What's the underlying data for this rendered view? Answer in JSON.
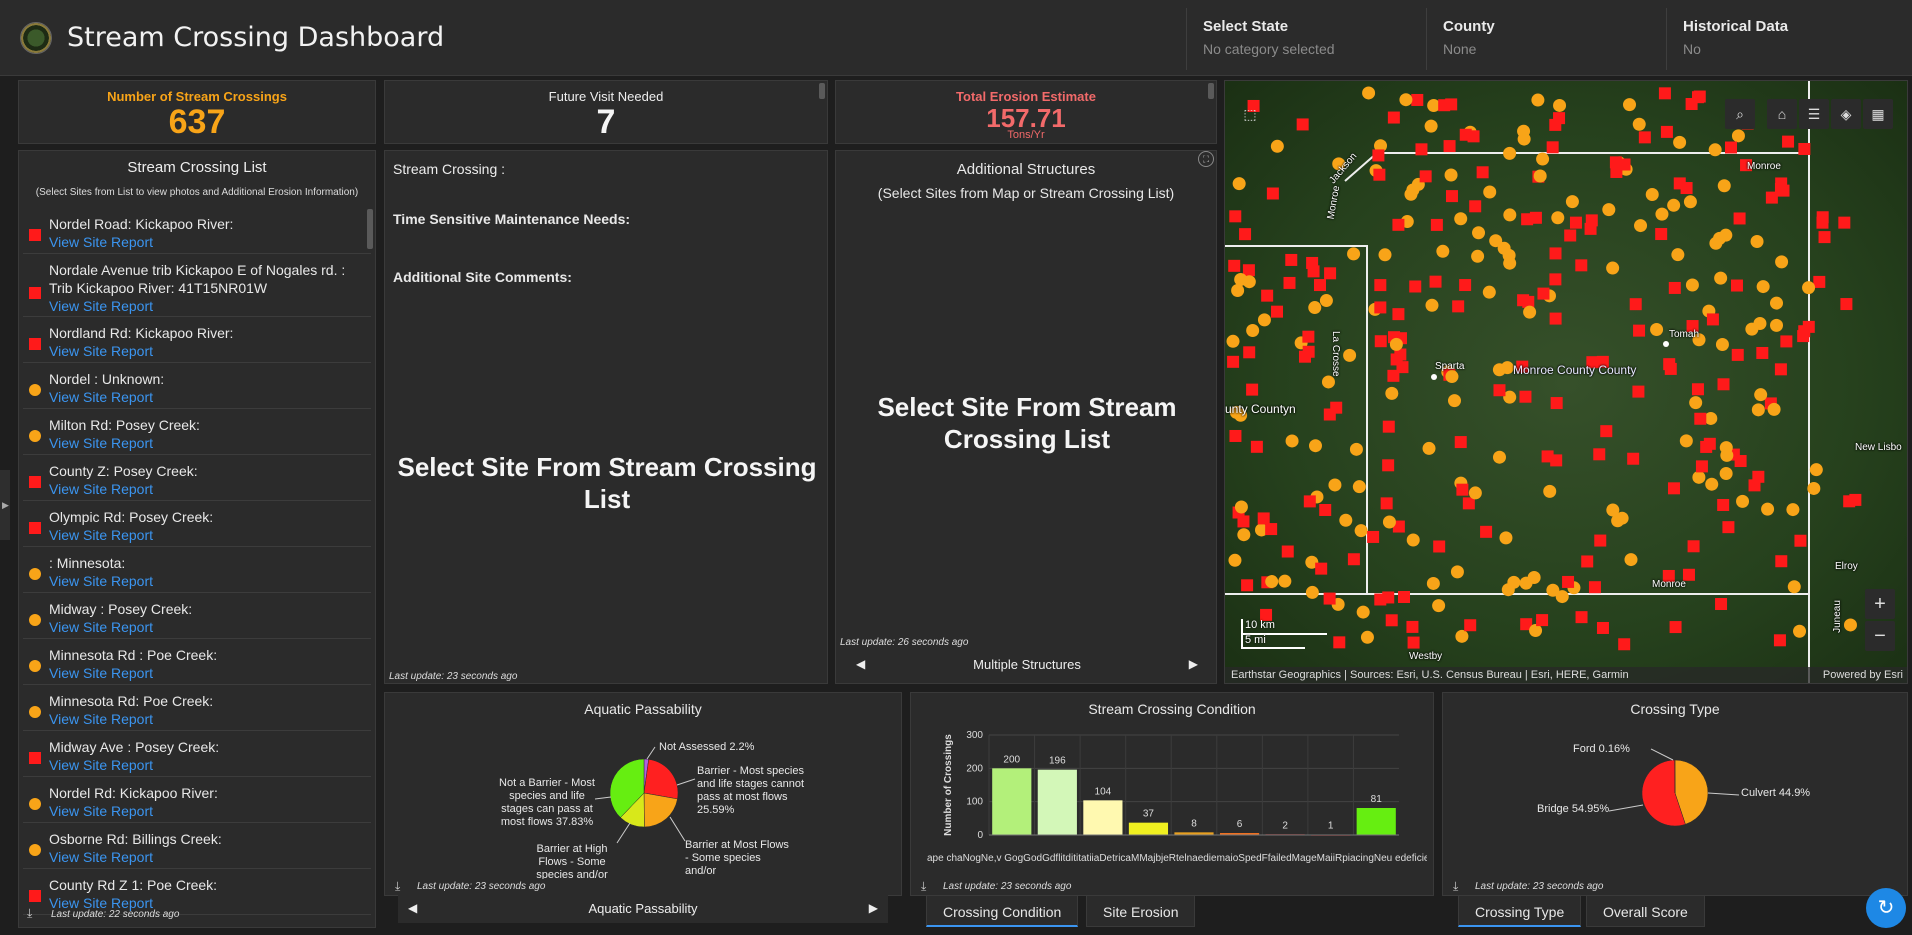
{
  "header": {
    "title": "Stream Crossing Dashboard",
    "filters": [
      {
        "label": "Select State",
        "value": "No category selected"
      },
      {
        "label": "County",
        "value": "None"
      },
      {
        "label": "Historical Data",
        "value": "No"
      }
    ]
  },
  "kpis": {
    "crossings": {
      "title": "Number of Stream Crossings",
      "value": "637",
      "color": "#f8a418"
    },
    "future_visit": {
      "title": "Future Visit Needed",
      "value": "7",
      "color": "#f5f5f5"
    },
    "erosion": {
      "title": "Total Erosion Estimate",
      "value": "157.71",
      "unit": "Tons/Yr",
      "color": "#f26a6a"
    }
  },
  "crossing_list": {
    "title": "Stream Crossing List",
    "subtitle": "(Select Sites  from List to view photos and Additional Erosion Information)",
    "link_label": "View Site Report",
    "items": [
      {
        "name": "Nordel Road: Kickapoo River:",
        "marker": "square"
      },
      {
        "name": "Nordale Avenue trib Kickapoo E of Nogales rd. : Trib Kickapoo River: 41T15NR01W",
        "marker": "square"
      },
      {
        "name": "Nordland Rd: Kickapoo River:",
        "marker": "square"
      },
      {
        "name": "Nordel : Unknown:",
        "marker": "circle"
      },
      {
        "name": "Milton Rd: Posey Creek:",
        "marker": "circle"
      },
      {
        "name": "County Z: Posey Creek:",
        "marker": "square"
      },
      {
        "name": "Olympic Rd: Posey Creek:",
        "marker": "square"
      },
      {
        "name": ": Minnesota:",
        "marker": "circle"
      },
      {
        "name": "Midway : Posey Creek:",
        "marker": "circle"
      },
      {
        "name": "Minnesota Rd : Poe Creek:",
        "marker": "circle"
      },
      {
        "name": "Minnesota Rd: Poe Creek:",
        "marker": "circle"
      },
      {
        "name": "Midway Ave : Posey Creek:",
        "marker": "square"
      },
      {
        "name": "Nordel Rd: Kickapoo River:",
        "marker": "circle"
      },
      {
        "name": "Osborne Rd: Billings Creek:",
        "marker": "circle"
      },
      {
        "name": "County Rd Z 1: Poe Creek:",
        "marker": "square"
      }
    ],
    "last_update": "Last update: 22 seconds ago"
  },
  "site_detail": {
    "stream_crossing_label": "Stream Crossing :",
    "maintenance_label": "Time Sensitive Maintenance Needs:",
    "comments_label": "Additional Site Comments:",
    "message": "Select Site From Stream Crossing List",
    "last_update": "Last update: 23 seconds ago"
  },
  "structures": {
    "title": "Additional Structures",
    "subtitle": "(Select Sites from Map or Stream Crossing List)",
    "message": "Select Site From Stream Crossing List",
    "last_update": "Last update: 26 seconds ago",
    "nav_label": "Multiple Structures"
  },
  "map": {
    "labels": {
      "jackson": "Jackson",
      "monroe_top": "Monroe",
      "monroe_left": "Monroe",
      "la_crosse": "La Crosse",
      "sparta": "Sparta",
      "tomah": "Tomah",
      "county": "Monroe County County",
      "county_left": "unty Countyn",
      "new_lisbon": "New Lisbo",
      "elroy": "Elroy",
      "monroe_bottom": "Monroe",
      "juneau": "Juneau",
      "westby": "Westby"
    },
    "scale_km": "10 km",
    "scale_mi": "5 mi",
    "attribution": "Earthstar Geographics | Sources: Esri, U.S. Census Bureau | Esri, HERE, Garmin",
    "powered_by": "Powered by Esri",
    "zoom_in": "+",
    "zoom_out": "−"
  },
  "aquatic": {
    "title": "Aquatic Passability",
    "labels": {
      "not_assessed": "Not Assessed 2.2%",
      "barrier_most": "Barrier - Most species and life stages cannot pass at most flows 25.59%",
      "barrier_high": "Barrier at Most Flows - Some species and/or",
      "not_barrier": "Not a Barrier - Most species and life stages can pass at most flows 37.83%",
      "barrier_at_high": "Barrier at High Flows - Some species and/or"
    },
    "last_update": "Last update: 23 seconds ago",
    "nav_label": "Aquatic Passability",
    "chart_data": {
      "type": "pie",
      "slices": [
        {
          "label": "Not a Barrier",
          "value": 37.83,
          "color": "#66ee11"
        },
        {
          "label": "Barrier - Most species and life stages cannot pass at most flows",
          "value": 25.59,
          "color": "#ff2020"
        },
        {
          "label": "Barrier at Most Flows",
          "value": 22.0,
          "color": "#f8a418"
        },
        {
          "label": "Barrier at High Flows",
          "value": 12.38,
          "color": "#d8e81a"
        },
        {
          "label": "Not Assessed",
          "value": 2.2,
          "color": "#b060e0"
        }
      ]
    }
  },
  "condition": {
    "title": "Stream Crossing Condition",
    "xtick_text": "ape chaNogNe,v GogGodGdflitdititatiiaDetricaMMajbjeRtelnaediemaioSpedFfailedMageMaiiRpiacingNeu edeficientbest",
    "last_update": "Last update: 23 seconds ago",
    "chart_data": {
      "type": "bar",
      "ylabel": "Number of Crossings",
      "ylim": [
        0,
        300
      ],
      "yticks": [
        0,
        100,
        200,
        300
      ],
      "values": [
        200,
        196,
        104,
        37,
        8,
        6,
        2,
        1,
        81
      ],
      "colors": [
        "#b3f07a",
        "#d3f7b8",
        "#fff9b0",
        "#f0f020",
        "#e8a020",
        "#f07020",
        "#ff3030",
        "#cc0000",
        "#66ee11"
      ]
    }
  },
  "crossing_type": {
    "title": "Crossing Type",
    "labels": {
      "ford": "Ford 0.16%",
      "culvert": "Culvert 44.9%",
      "bridge": "Bridge 54.95%"
    },
    "last_update": "Last update: 23 seconds ago",
    "chart_data": {
      "type": "pie",
      "slices": [
        {
          "label": "Culvert",
          "value": 44.9,
          "color": "#f8a418"
        },
        {
          "label": "Bridge",
          "value": 54.95,
          "color": "#ff2020"
        },
        {
          "label": "Ford",
          "value": 0.16,
          "color": "#f8a418"
        }
      ]
    }
  },
  "tabs": {
    "crossing_condition": "Crossing Condition",
    "site_erosion": "Site Erosion",
    "crossing_type": "Crossing Type",
    "overall_score": "Overall Score"
  }
}
